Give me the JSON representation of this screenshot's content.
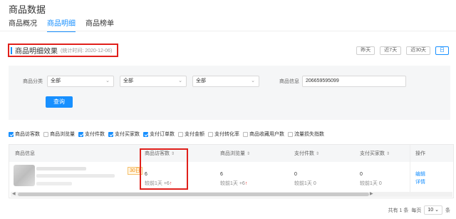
{
  "page": {
    "title": "商品数据"
  },
  "tabs": [
    {
      "label": "商品概况"
    },
    {
      "label": "商品明细"
    },
    {
      "label": "商品榜单"
    }
  ],
  "section": {
    "title": "商品明细效果",
    "time": "(统计时间: 2020-12-06)"
  },
  "date_range": {
    "yesterday": "昨天",
    "last7": "近7天",
    "last30": "近30天",
    "calendar": "日"
  },
  "filters": {
    "category_label": "商品分类",
    "category_values": [
      "全部",
      "全部",
      "全部"
    ],
    "info_label": "商品信息",
    "info_value": "206659595099",
    "query_label": "查询"
  },
  "metrics": [
    {
      "label": "商品访客数",
      "checked": true
    },
    {
      "label": "商品浏览量",
      "checked": false
    },
    {
      "label": "支付件数",
      "checked": true
    },
    {
      "label": "支付买家数",
      "checked": true
    },
    {
      "label": "支付订单数",
      "checked": true
    },
    {
      "label": "支付金额",
      "checked": false
    },
    {
      "label": "支付转化率",
      "checked": false
    },
    {
      "label": "商品收藏用户数",
      "checked": false
    },
    {
      "label": "流量损失指数",
      "checked": false
    }
  ],
  "table": {
    "headers": {
      "info": "商品信息",
      "visitors": "商品访客数",
      "views": "商品浏览量",
      "pay_items": "支付件数",
      "pay_buyers": "支付买家数",
      "ops": "操作"
    },
    "sort_symbol": "⇕",
    "row": {
      "badge": "30日",
      "visitors": "6",
      "visitors_cmp": "较前1天 +6",
      "views": "6",
      "views_cmp": "较前1天 +6",
      "pay_items": "0",
      "pay_items_cmp": "较前1天 0",
      "pay_buyers": "0",
      "pay_buyers_cmp": "较前1天 0",
      "edit": "编辑",
      "detail": "详情"
    },
    "up_arrow": "↑"
  },
  "pager": {
    "total": "共有 1 条",
    "per_page_label": "每页",
    "per_page": "10",
    "unit": "条"
  },
  "colors": {
    "accent": "#1890ff",
    "highlight": "#e0201b"
  }
}
